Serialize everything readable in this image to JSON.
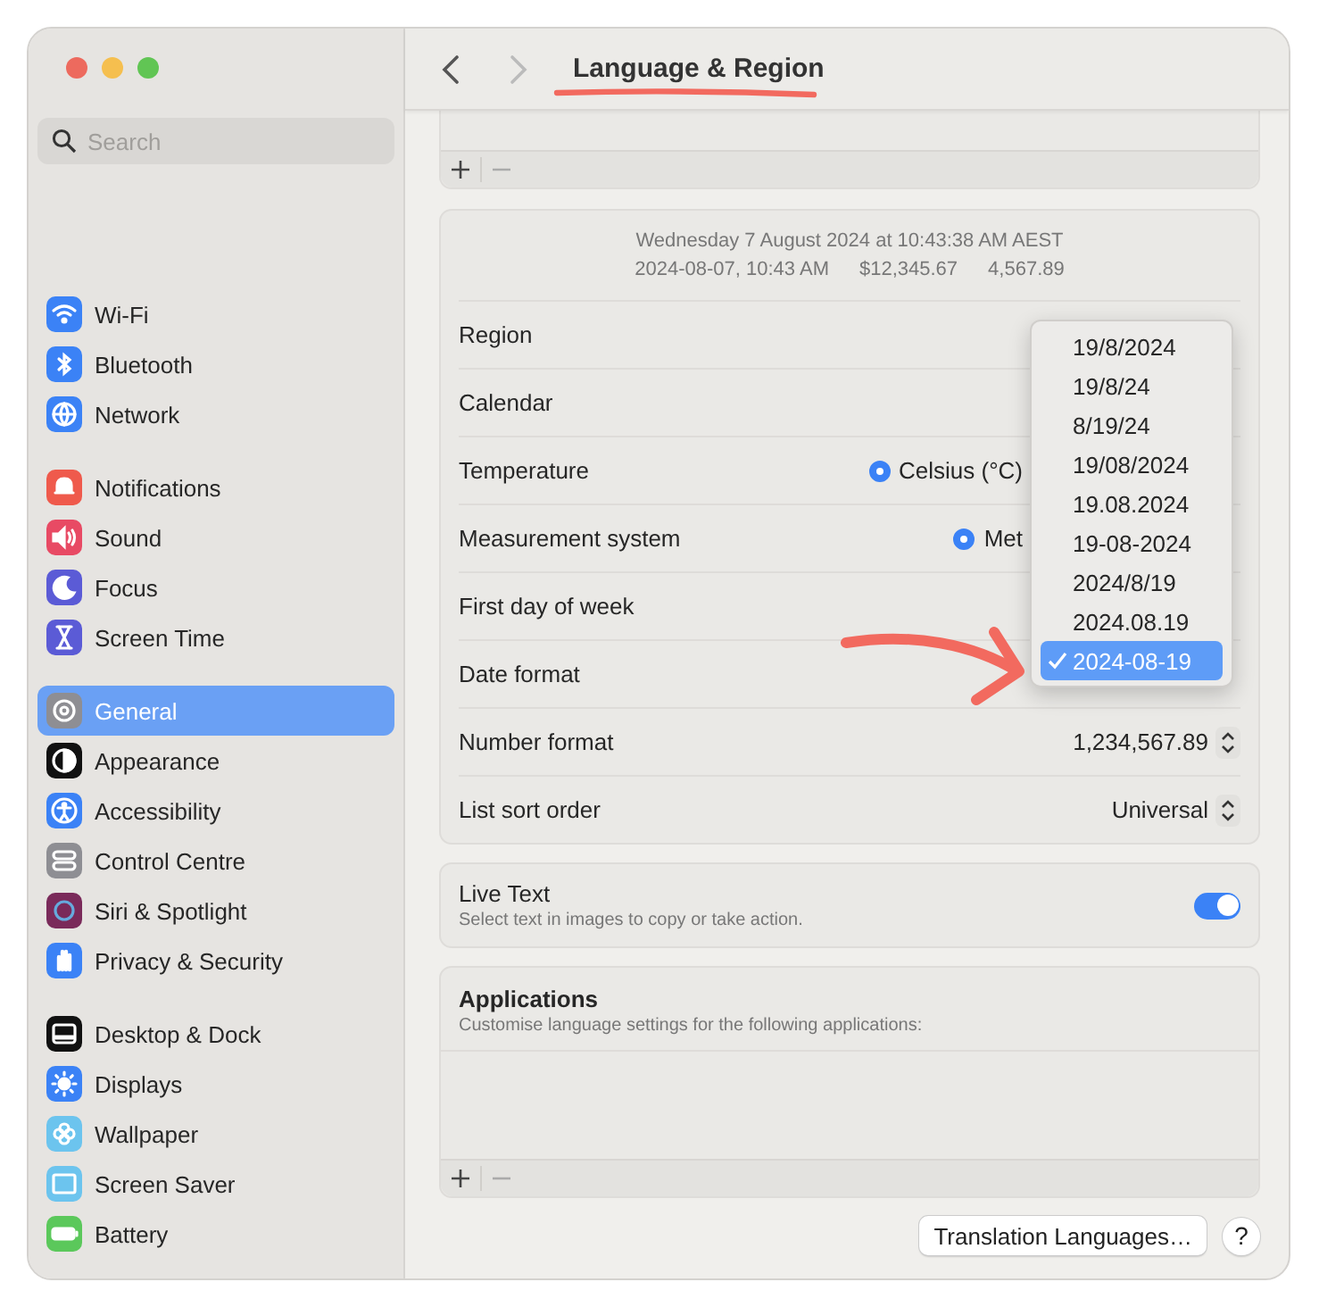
{
  "window": {
    "title": "Language & Region"
  },
  "toolbar": {
    "back_disabled": false,
    "forward_disabled": true
  },
  "sidebar": {
    "search": {
      "placeholder": "Search"
    },
    "groups": [
      [
        {
          "label": "Wi-Fi",
          "selected": false
        },
        {
          "label": "Bluetooth",
          "selected": false
        },
        {
          "label": "Network",
          "selected": false
        }
      ],
      [
        {
          "label": "Notifications",
          "selected": false
        },
        {
          "label": "Sound",
          "selected": false
        },
        {
          "label": "Focus",
          "selected": false
        },
        {
          "label": "Screen Time",
          "selected": false
        }
      ],
      [
        {
          "label": "General",
          "selected": true
        },
        {
          "label": "Appearance",
          "selected": false
        },
        {
          "label": "Accessibility",
          "selected": false
        },
        {
          "label": "Control Centre",
          "selected": false
        },
        {
          "label": "Siri & Spotlight",
          "selected": false
        },
        {
          "label": "Privacy & Security",
          "selected": false
        }
      ],
      [
        {
          "label": "Desktop & Dock",
          "selected": false
        },
        {
          "label": "Displays",
          "selected": false
        },
        {
          "label": "Wallpaper",
          "selected": false
        },
        {
          "label": "Screen Saver",
          "selected": false
        },
        {
          "label": "Battery",
          "selected": false
        }
      ]
    ]
  },
  "format_preview": [
    "Wednesday 7 August 2024 at 10:43:38 AM AEST",
    [
      "2024-08-07, 10:43 AM",
      "$12,345.67",
      "4,567.89"
    ]
  ],
  "settings": [
    {
      "kind": "popup",
      "label": "Region"
    },
    {
      "kind": "popup",
      "label": "Calendar"
    },
    {
      "kind": "radio",
      "label": "Temperature",
      "options": [
        {
          "label": "Celsius (°C)",
          "selected": true
        }
      ]
    },
    {
      "kind": "radio",
      "label": "Measurement system",
      "options": [
        {
          "label": "Met",
          "selected": true
        }
      ]
    },
    {
      "kind": "popup",
      "label": "First day of week"
    },
    {
      "kind": "popup",
      "label": "Date format"
    },
    {
      "kind": "popup",
      "label": "Number format",
      "value": "1,234,567.89"
    },
    {
      "kind": "popup",
      "label": "List sort order",
      "value": "Universal"
    }
  ],
  "date_format_menu": [
    {
      "label": "19/8/2024",
      "selected": false
    },
    {
      "label": "19/8/24",
      "selected": false
    },
    {
      "label": "8/19/24",
      "selected": false
    },
    {
      "label": "19/08/2024",
      "selected": false
    },
    {
      "label": "19.08.2024",
      "selected": false
    },
    {
      "label": "19-08-2024",
      "selected": false
    },
    {
      "label": "2024/8/19",
      "selected": false
    },
    {
      "label": "2024.08.19",
      "selected": false
    },
    {
      "label": "2024-08-19",
      "selected": true
    }
  ],
  "live_text": {
    "title": "Live Text",
    "description": "Select text in images to copy or take action.",
    "on": true
  },
  "applications": {
    "title": "Applications",
    "description": "Customise language settings for the following applications:"
  },
  "footer": {
    "button": "Translation Languages…",
    "help": "?"
  }
}
